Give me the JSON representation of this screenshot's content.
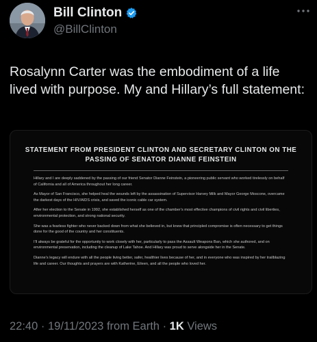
{
  "author": {
    "display_name": "Bill Clinton",
    "handle": "@BillClinton",
    "verified_color": "#1d9bf0"
  },
  "tweet": {
    "text": "Rosalynn Carter was the embodiment of a life lived with purpose. My and Hillary’s full statement:"
  },
  "statement": {
    "title": "STATEMENT FROM PRESIDENT CLINTON AND SECRETARY CLINTON ON THE PASSING OF SENATOR DIANNE FEINSTEIN",
    "paragraphs": [
      "Hillary and I are deeply saddened by the passing of our friend Senator Dianne Feinstein, a pioneering public servant who worked tirelessly on behalf of California and all of America throughout her long career.",
      "As Mayor of San Francisco, she helped heal the wounds left by the assassination of Supervisor Harvey Milk and Mayor George Moscone, overcame the darkest days of the HIV/AIDS crisis, and saved the iconic cable car system.",
      "After her election to the Senate in 1992, she established herself as one of the chamber’s most effective champions of civil rights and civil liberties, environmental protection, and strong national security.",
      "She was a fearless fighter who never backed down from what she believed in, but knew that principled compromise is often necessary to get things done for the good of the country and her constituents.",
      "I’ll always be grateful for the opportunity to work closely with her, particularly to pass the Assault Weapons Ban, which she authored, and on environmental preservation, including the cleanup of Lake Tahoe. And Hillary was proud to serve alongside her in the Senate.",
      "Dianne’s legacy will endure with all the people living better, safer, healthier lives because of her, and in everyone who was inspired by her trailblazing life and career. Our thoughts and prayers are with Katherine, Eileen, and all the people who loved her."
    ]
  },
  "meta": {
    "time": "22:40",
    "date": "19/11/2023",
    "source": "from Earth",
    "separator": "·",
    "views_count": "1K",
    "views_label": "Views"
  },
  "icons": {
    "verified": "verified-badge-icon",
    "more": "more-options-icon"
  }
}
